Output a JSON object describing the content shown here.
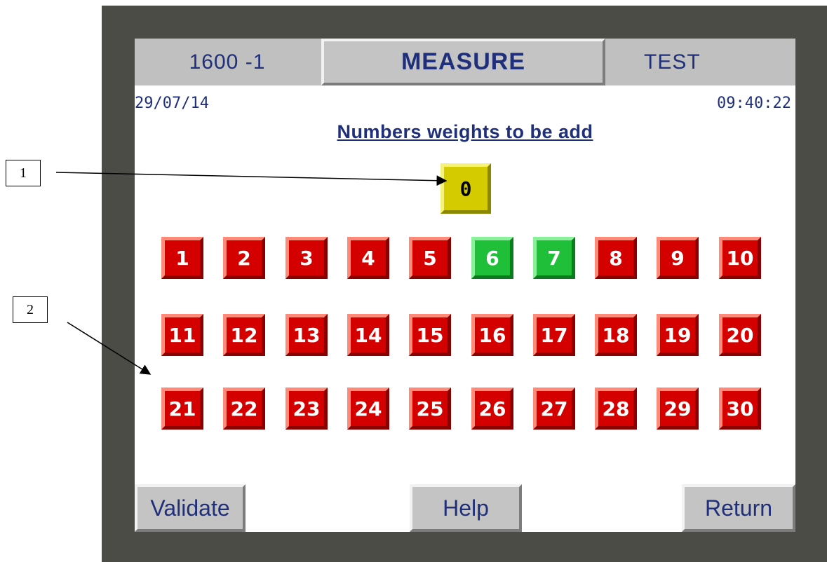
{
  "header": {
    "left_label": "1600  -1",
    "title": "MEASURE",
    "right_label": "TEST"
  },
  "status": {
    "date": "29/07/14",
    "time": "09:40:22"
  },
  "main": {
    "title": "Numbers weights to be add",
    "counter": "0",
    "weights": [
      {
        "label": "1",
        "state": "red"
      },
      {
        "label": "2",
        "state": "red"
      },
      {
        "label": "3",
        "state": "red"
      },
      {
        "label": "4",
        "state": "red"
      },
      {
        "label": "5",
        "state": "red"
      },
      {
        "label": "6",
        "state": "green"
      },
      {
        "label": "7",
        "state": "green"
      },
      {
        "label": "8",
        "state": "red"
      },
      {
        "label": "9",
        "state": "red"
      },
      {
        "label": "10",
        "state": "red"
      },
      {
        "label": "11",
        "state": "red"
      },
      {
        "label": "12",
        "state": "red"
      },
      {
        "label": "13",
        "state": "red"
      },
      {
        "label": "14",
        "state": "red"
      },
      {
        "label": "15",
        "state": "red"
      },
      {
        "label": "16",
        "state": "red"
      },
      {
        "label": "17",
        "state": "red"
      },
      {
        "label": "18",
        "state": "red"
      },
      {
        "label": "19",
        "state": "red"
      },
      {
        "label": "20",
        "state": "red"
      },
      {
        "label": "21",
        "state": "red"
      },
      {
        "label": "22",
        "state": "red"
      },
      {
        "label": "23",
        "state": "red"
      },
      {
        "label": "24",
        "state": "red"
      },
      {
        "label": "25",
        "state": "red"
      },
      {
        "label": "26",
        "state": "red"
      },
      {
        "label": "27",
        "state": "red"
      },
      {
        "label": "28",
        "state": "red"
      },
      {
        "label": "29",
        "state": "red"
      },
      {
        "label": "30",
        "state": "red"
      }
    ]
  },
  "footer": {
    "validate_label": "Validate",
    "help_label": "Help",
    "return_label": "Return"
  },
  "callouts": {
    "one": "1",
    "two": "2"
  },
  "colors": {
    "bezel": "#4c4c46",
    "header_bg": "#c0c0c0",
    "text_blue": "#1f2f7a",
    "button_red": "#d40000",
    "button_green": "#1fbf3a",
    "counter_yellow": "#d4cc00"
  }
}
